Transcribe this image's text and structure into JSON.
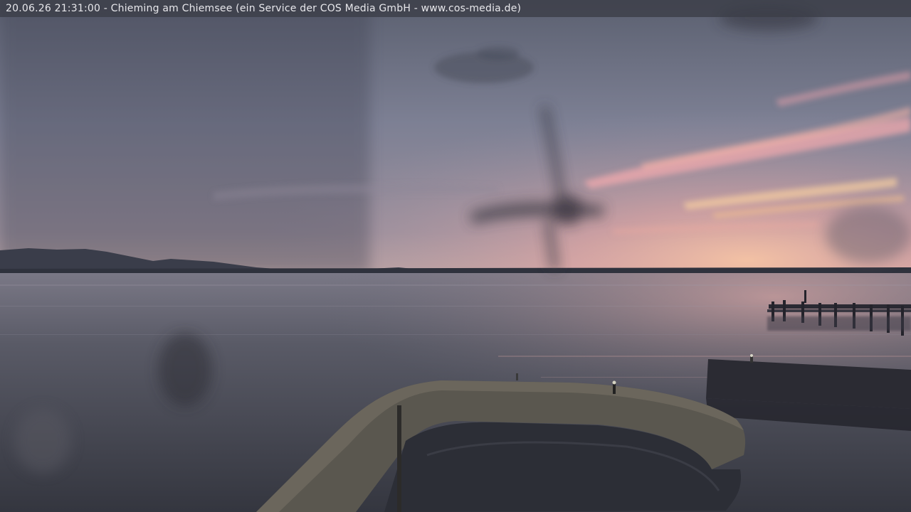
{
  "overlay": {
    "timestamp": "20.06.26 21:31:00",
    "separator": " - ",
    "caption": "Chieming am Chiemsee (ein Service der COS Media GmbH - www.cos-media.de)"
  },
  "colors": {
    "sky_top": "#5d6373",
    "sky_horizon_glow": "#f2b39a",
    "water": "#4a4c57",
    "overlay_bar": "#3c3e48",
    "overlay_text": "#e8e8ec"
  }
}
